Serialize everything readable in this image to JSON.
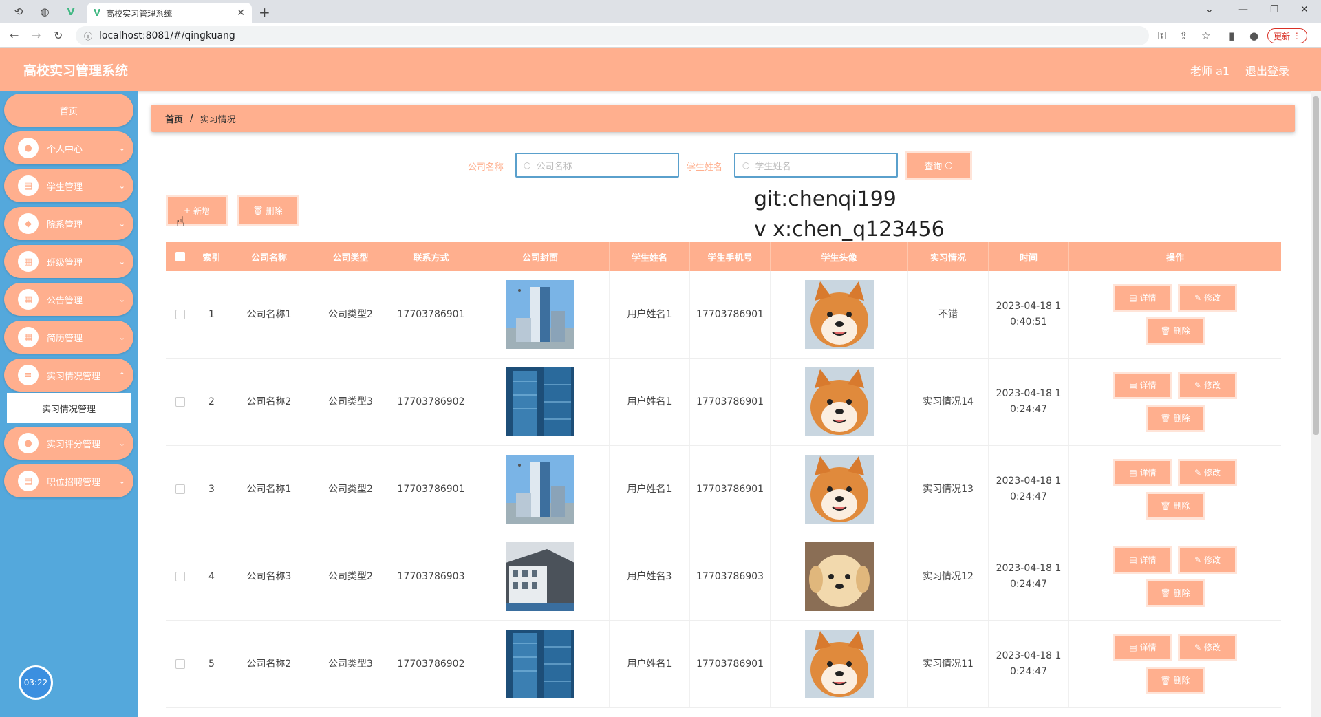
{
  "browser": {
    "tab_title": "高校实习管理系统",
    "tab_icon": "vue-icon",
    "url": "localhost:8081/#/qingkuang",
    "update_label": "更新"
  },
  "header": {
    "title": "高校实习管理系统",
    "user": "老师 a1",
    "logout": "退出登录"
  },
  "sidebar": {
    "items": [
      {
        "label": "首页",
        "icon": "home-icon"
      },
      {
        "label": "个人中心",
        "icon": "user-icon"
      },
      {
        "label": "学生管理",
        "icon": "clipboard-icon"
      },
      {
        "label": "院系管理",
        "icon": "location-icon"
      },
      {
        "label": "班级管理",
        "icon": "grid-icon"
      },
      {
        "label": "公告管理",
        "icon": "grid-icon"
      },
      {
        "label": "简历管理",
        "icon": "grid-icon"
      },
      {
        "label": "实习情况管理",
        "icon": "menu-icon"
      },
      {
        "label": "实习评分管理",
        "icon": "user-icon"
      },
      {
        "label": "职位招聘管理",
        "icon": "clipboard-icon"
      }
    ],
    "submenu_active": "实习情况管理",
    "timer": "03:22"
  },
  "breadcrumb": {
    "home": "首页",
    "sep": "/",
    "current": "实习情况"
  },
  "search": {
    "company_label": "公司名称",
    "company_placeholder": "公司名称",
    "student_label": "学生姓名",
    "student_placeholder": "学生姓名",
    "query_label": "查询"
  },
  "actions": {
    "add_label": "新增",
    "delete_label": "删除"
  },
  "watermark": {
    "line1": "git:chenqi199",
    "line2": "v x:chen_q123456"
  },
  "table": {
    "headers": [
      "索引",
      "公司名称",
      "公司类型",
      "联系方式",
      "公司封面",
      "学生姓名",
      "学生手机号",
      "学生头像",
      "实习情况",
      "时间",
      "操作"
    ],
    "op_labels": {
      "detail": "详情",
      "edit": "修改",
      "delete": "删除"
    },
    "rows": [
      {
        "index": "1",
        "company": "公司名称1",
        "type": "公司类型2",
        "phone": "17703786901",
        "cover": "building-a",
        "student": "用户姓名1",
        "student_phone": "17703786901",
        "avatar": "shiba",
        "situation": "不错",
        "time1": "2023-04-18 1",
        "time2": "0:40:51"
      },
      {
        "index": "2",
        "company": "公司名称2",
        "type": "公司类型3",
        "phone": "17703786902",
        "cover": "building-b",
        "student": "用户姓名1",
        "student_phone": "17703786901",
        "avatar": "shiba",
        "situation": "实习情况14",
        "time1": "2023-04-18 1",
        "time2": "0:24:47"
      },
      {
        "index": "3",
        "company": "公司名称1",
        "type": "公司类型2",
        "phone": "17703786901",
        "cover": "building-a",
        "student": "用户姓名1",
        "student_phone": "17703786901",
        "avatar": "shiba",
        "situation": "实习情况13",
        "time1": "2023-04-18 1",
        "time2": "0:24:47"
      },
      {
        "index": "4",
        "company": "公司名称3",
        "type": "公司类型2",
        "phone": "17703786903",
        "cover": "building-c",
        "student": "用户姓名3",
        "student_phone": "17703786903",
        "avatar": "puppy",
        "situation": "实习情况12",
        "time1": "2023-04-18 1",
        "time2": "0:24:47"
      },
      {
        "index": "5",
        "company": "公司名称2",
        "type": "公司类型3",
        "phone": "17703786902",
        "cover": "building-b",
        "student": "用户姓名1",
        "student_phone": "17703786901",
        "avatar": "shiba",
        "situation": "实习情况11",
        "time1": "2023-04-18 1",
        "time2": "0:24:47"
      }
    ]
  },
  "colors": {
    "accent": "#ffaf8e",
    "sidebar": "#54a8dc",
    "input_border": "#5aa0cc"
  }
}
